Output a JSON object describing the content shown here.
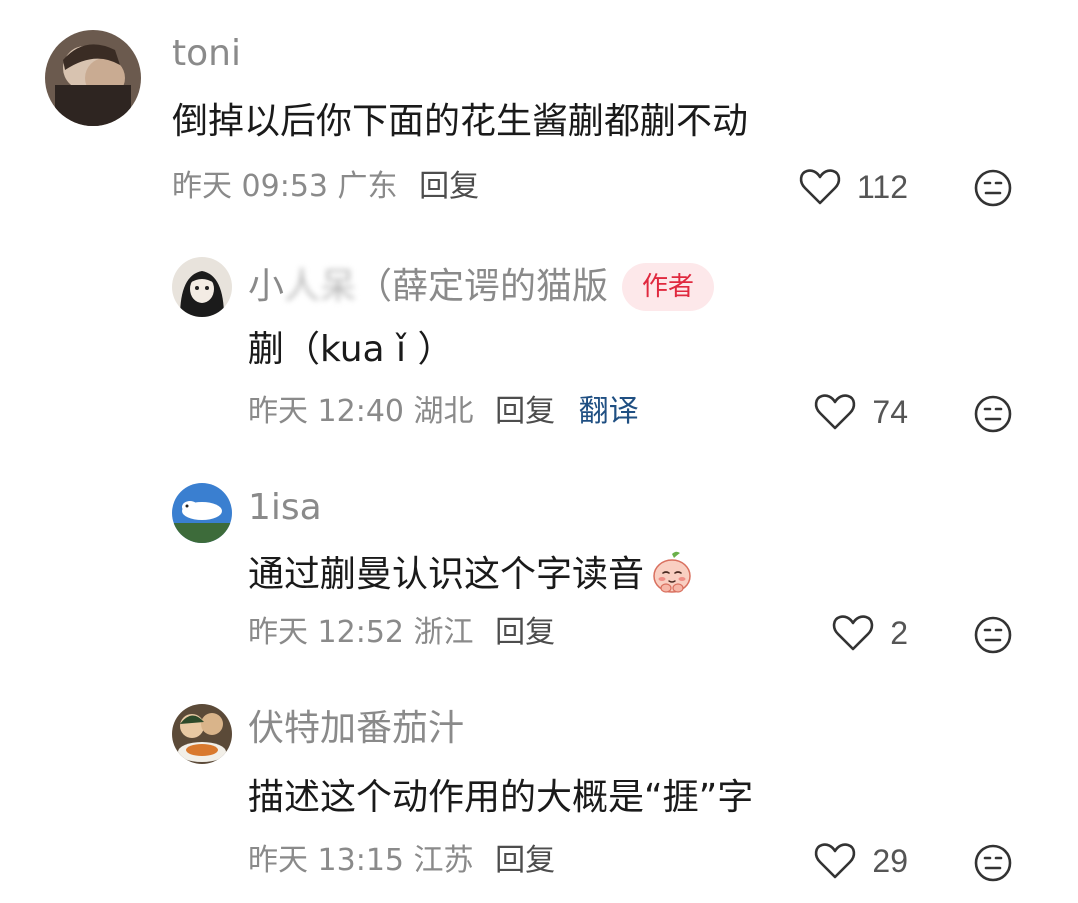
{
  "comments": [
    {
      "username": "toni",
      "content": "倒掉以后你下面的花生酱蒯都蒯不动",
      "time": "昨天 09:53",
      "location": "广东",
      "reply_label": "回复",
      "likes": "112"
    },
    {
      "username_visible": "小",
      "username_blurred": "人呆",
      "username_rest": "（薛定谔的猫版",
      "badge": "作者",
      "content": "蒯（kua ǐ ）",
      "time": "昨天 12:40",
      "location": "湖北",
      "reply_label": "回复",
      "translate_label": "翻译",
      "likes": "74"
    },
    {
      "username": "1isa",
      "content": "通过蒯曼认识这个字读音",
      "time": "昨天 12:52",
      "location": "浙江",
      "reply_label": "回复",
      "likes": "2"
    },
    {
      "username": "伏特加番茄汁",
      "content": "描述这个动作用的大概是“捱”字",
      "time": "昨天 13:15",
      "location": "江苏",
      "reply_label": "回复",
      "likes": "29"
    }
  ],
  "icons": {
    "like": "heart-outline-icon",
    "more": "neutral-face-icon",
    "emoji": "shy-peach-emoji"
  },
  "colors": {
    "secondary_text": "#8a8a8a",
    "badge_bg": "#fde8ea",
    "badge_text": "#e0293f",
    "translate": "#1f4f82"
  }
}
